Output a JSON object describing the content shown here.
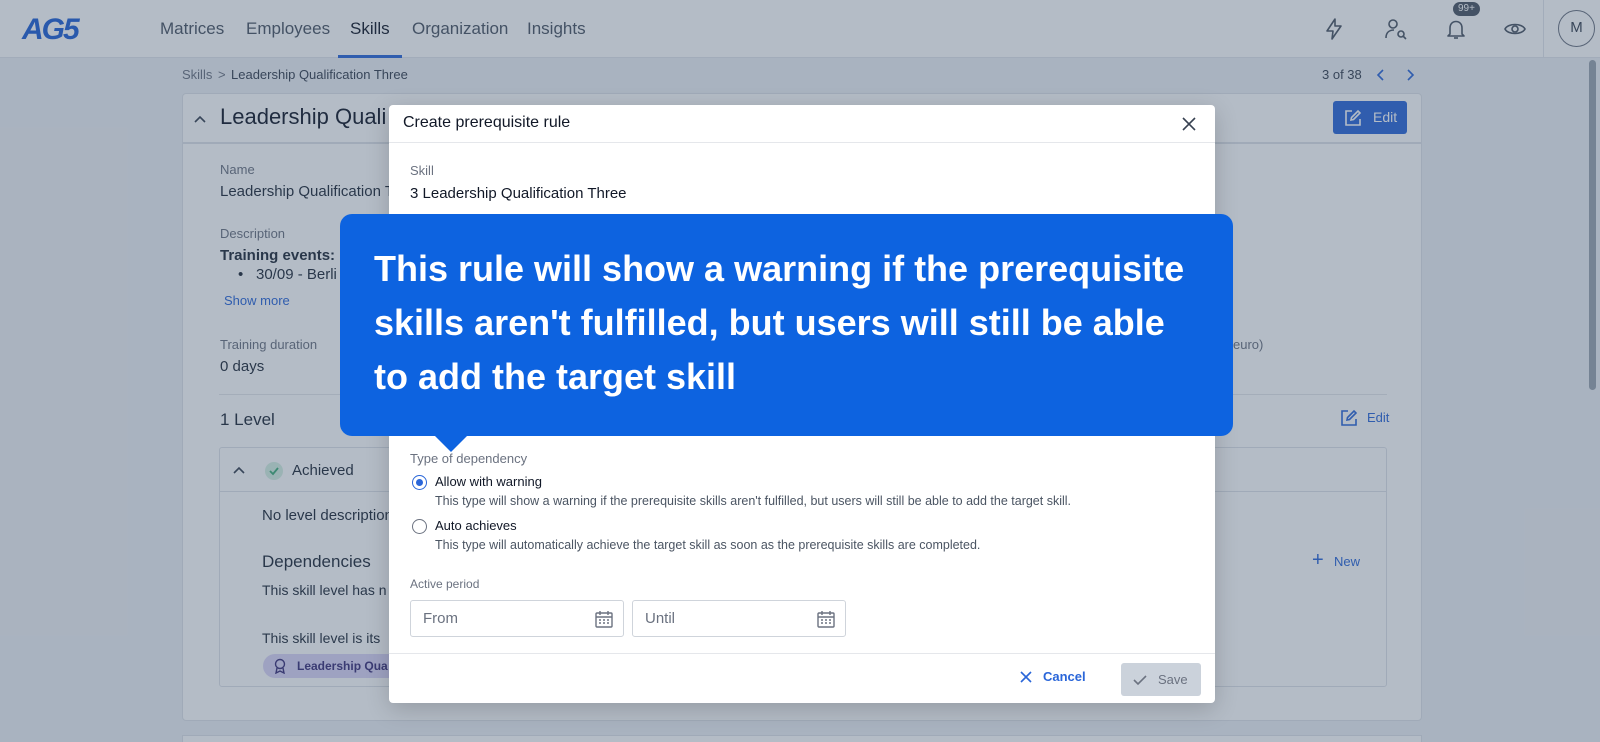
{
  "app": {
    "logo": "AG5"
  },
  "nav": {
    "tabs": [
      {
        "label": "Matrices"
      },
      {
        "label": "Employees"
      },
      {
        "label": "Skills"
      },
      {
        "label": "Organization"
      },
      {
        "label": "Insights"
      }
    ],
    "active_tab": "Skills",
    "notification_badge": "99+",
    "avatar_initial": "M",
    "icons": [
      "lightning-icon",
      "user-search-icon",
      "bell-icon",
      "eye-icon"
    ]
  },
  "breadcrumb": {
    "root": "Skills",
    "separator": ">",
    "current": "Leadership Qualification Three"
  },
  "pager": {
    "text": "3 of 38"
  },
  "skill_card": {
    "title": "Leadership Quali",
    "edit_label": "Edit",
    "name_label": "Name",
    "name_value": "Leadership Qualification T",
    "description_label": "Description",
    "description_heading": "Training events:",
    "description_item": "30/09 - Berli",
    "show_more": "Show more",
    "duration_label": "Training duration",
    "duration_value": "0 days",
    "cost_label_tail": "euro)",
    "level_heading": "1 Level",
    "level_edit_label": "Edit",
    "level_status": "Achieved",
    "no_level_desc": "No level description",
    "dependencies_heading": "Dependencies",
    "dependency_text_1": "This skill level has n",
    "dependency_text_2": "This skill level is its",
    "new_label": "New",
    "chip_label": "Leadership Qua"
  },
  "modal": {
    "title": "Create prerequisite rule",
    "skill_label": "Skill",
    "skill_value": "3 Leadership Qualification Three",
    "type_label": "Type of dependency",
    "options": [
      {
        "label": "Allow with warning",
        "description": "This type will show a warning if the prerequisite skills aren't fulfilled, but users will still be able to add the target skill.",
        "selected": true
      },
      {
        "label": "Auto achieves",
        "description": "This type will automatically achieve the target skill as soon as the prerequisite skills are completed.",
        "selected": false
      }
    ],
    "active_period_label": "Active period",
    "from_placeholder": "From",
    "until_placeholder": "Until",
    "cancel_label": "Cancel",
    "save_label": "Save"
  },
  "tooltip": {
    "text": "This rule will show a warning if the prerequisite skills aren't fulfilled, but users will still be able to add the target skill"
  },
  "colors": {
    "primary": "#2a66d9",
    "tooltip_bg": "#0d63e0",
    "overlay": "#3a4e68",
    "chip_bg": "#dcd6f7",
    "success": "#3fae7a"
  }
}
